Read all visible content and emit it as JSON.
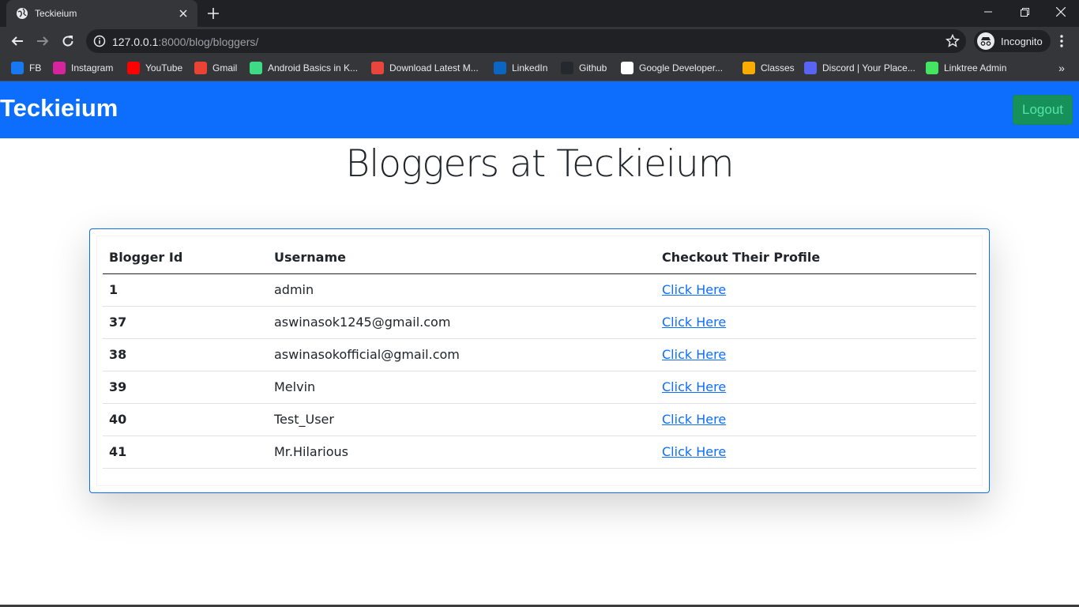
{
  "browser": {
    "tab_title": "Teckieium",
    "url_host": "127.0.0.1",
    "url_rest": ":8000/blog/bloggers/",
    "profile_label": "Incognito",
    "bookmarks": [
      {
        "label": "FB",
        "icon": "facebook-icon",
        "color": "#1877f2"
      },
      {
        "label": "Instagram",
        "icon": "instagram-icon",
        "color": "#d6249f"
      },
      {
        "label": "YouTube",
        "icon": "youtube-icon",
        "color": "#ff0000"
      },
      {
        "label": "Gmail",
        "icon": "gmail-icon",
        "color": "#ea4335"
      },
      {
        "label": "Android Basics in K...",
        "icon": "android-icon",
        "color": "#3ddc84"
      },
      {
        "label": "Download Latest M...",
        "icon": "download-site-icon",
        "color": "#e8453c"
      },
      {
        "label": "LinkedIn",
        "icon": "linkedin-icon",
        "color": "#0a66c2"
      },
      {
        "label": "Github",
        "icon": "github-icon",
        "color": "#24292e"
      },
      {
        "label": "Google Developer...",
        "icon": "google-developers-icon",
        "color": "#ffffff"
      },
      {
        "label": "Classes",
        "icon": "classroom-icon",
        "color": "#f9ab00"
      },
      {
        "label": "Discord | Your Place...",
        "icon": "discord-icon",
        "color": "#5865f2"
      },
      {
        "label": "Linktree Admin",
        "icon": "linktree-icon",
        "color": "#43e660"
      }
    ]
  },
  "navbar": {
    "brand": "Teckieium",
    "logout_label": "Logout"
  },
  "page": {
    "heading": "Bloggers at Teckieium"
  },
  "table": {
    "headers": [
      "Blogger Id",
      "Username",
      "Checkout Their Profile"
    ],
    "rows": [
      {
        "id": "1",
        "username": "admin",
        "link": "Click Here"
      },
      {
        "id": "37",
        "username": "aswinasok1245@gmail.com",
        "link": "Click Here"
      },
      {
        "id": "38",
        "username": "aswinasokofficial@gmail.com",
        "link": "Click Here"
      },
      {
        "id": "39",
        "username": "Melvin",
        "link": "Click Here"
      },
      {
        "id": "40",
        "username": "Test_User",
        "link": "Click Here"
      },
      {
        "id": "41",
        "username": "Mr.Hilarious",
        "link": "Click Here"
      }
    ]
  },
  "colors": {
    "navbar_bg": "#0d6efd",
    "logout_bg": "#17915a",
    "link": "#0d6efd",
    "card_border": "#0d6efd"
  }
}
